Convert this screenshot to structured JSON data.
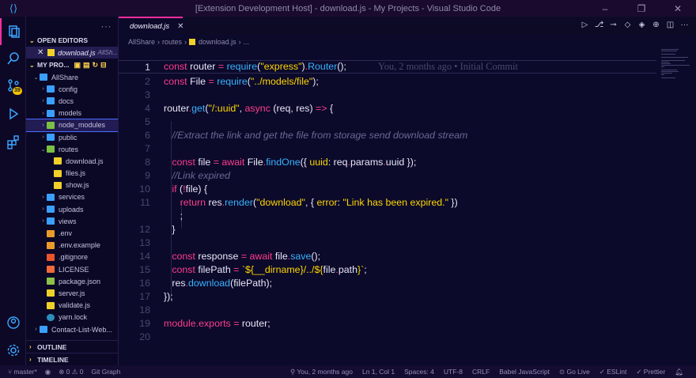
{
  "window": {
    "title": "[Extension Development Host] - download.js - My Projects - Visual Studio Code"
  },
  "sidebar": {
    "open_editors_label": "OPEN EDITORS",
    "open_editor": {
      "name": "download.js",
      "path": "AllSh..."
    },
    "project_label": "MY PRO...",
    "tree": [
      {
        "name": "AllShare",
        "type": "folder",
        "level": 0,
        "open": true
      },
      {
        "name": "config",
        "type": "folder",
        "level": 1
      },
      {
        "name": "docs",
        "type": "folder",
        "level": 1
      },
      {
        "name": "models",
        "type": "folder",
        "level": 1
      },
      {
        "name": "node_modules",
        "type": "folder-green",
        "level": 1,
        "selected": true
      },
      {
        "name": "public",
        "type": "folder",
        "level": 1
      },
      {
        "name": "routes",
        "type": "folder-green",
        "level": 1,
        "open": true
      },
      {
        "name": "download.js",
        "type": "js",
        "level": 2
      },
      {
        "name": "files.js",
        "type": "js",
        "level": 2
      },
      {
        "name": "show.js",
        "type": "js",
        "level": 2
      },
      {
        "name": "services",
        "type": "folder",
        "level": 1
      },
      {
        "name": "uploads",
        "type": "folder",
        "level": 1
      },
      {
        "name": "views",
        "type": "folder",
        "level": 1
      },
      {
        "name": ".env",
        "type": "env",
        "level": 1
      },
      {
        "name": ".env.example",
        "type": "env",
        "level": 1
      },
      {
        "name": ".gitignore",
        "type": "git",
        "level": 1
      },
      {
        "name": "LICENSE",
        "type": "lic",
        "level": 1
      },
      {
        "name": "package.json",
        "type": "json",
        "level": 1
      },
      {
        "name": "server.js",
        "type": "js",
        "level": 1
      },
      {
        "name": "validate.js",
        "type": "js",
        "level": 1
      },
      {
        "name": "yarn.lock",
        "type": "yarn",
        "level": 1
      },
      {
        "name": "Contact-List-Web...",
        "type": "folder",
        "level": 0
      }
    ],
    "outline_label": "OUTLINE",
    "timeline_label": "TIMELINE"
  },
  "activity": {
    "scm_badge": "39"
  },
  "tab": {
    "label": "download.js"
  },
  "breadcrumb": [
    "AllShare",
    "routes",
    "download.js",
    "..."
  ],
  "editor": {
    "blame": "You, 2 months ago • Initial Commit",
    "line_numbers": [
      "1",
      "2",
      "3",
      "4",
      "5",
      "6",
      "7",
      "8",
      "9",
      "10",
      "11",
      "",
      "12",
      "13",
      "14",
      "15",
      "16",
      "17",
      "18",
      "19",
      "20"
    ]
  },
  "statusbar": {
    "branch": "master*",
    "problems": "⊗ 0 ⚠ 0",
    "git_graph": "Git Graph",
    "blame": "You, 2 months ago",
    "position": "Ln 1, Col 1",
    "spaces": "Spaces: 4",
    "encoding": "UTF-8",
    "eol": "CRLF",
    "language": "Babel JavaScript",
    "golive": "Go Live",
    "eslint": "ESLint",
    "prettier": "Prettier"
  }
}
